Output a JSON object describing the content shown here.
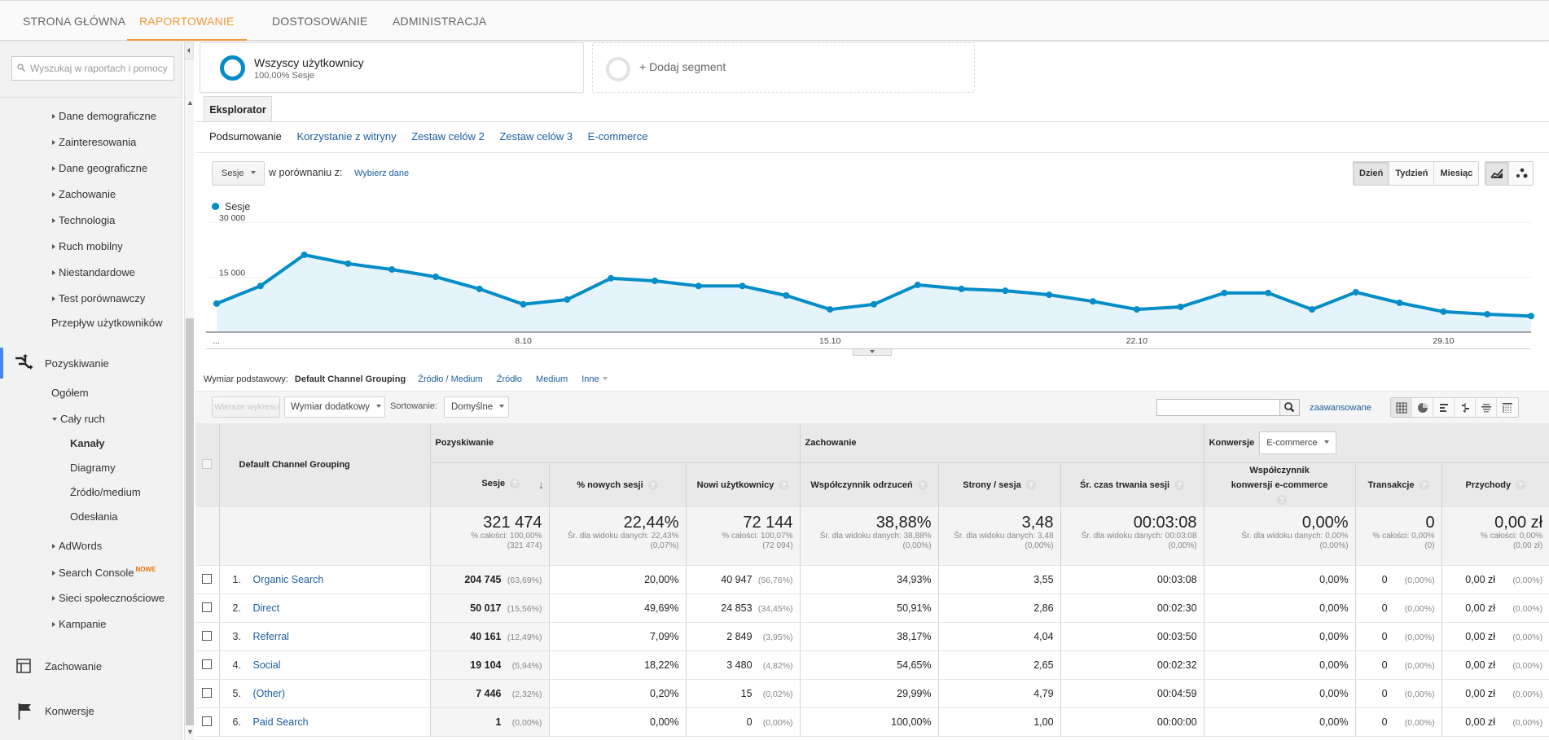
{
  "topnav": {
    "tabs": [
      {
        "label": "STRONA GŁÓWNA",
        "active": false
      },
      {
        "label": "RAPORTOWANIE",
        "active": true
      },
      {
        "label": "DOSTOSOWANIE",
        "active": false
      },
      {
        "label": "ADMINISTRACJA",
        "active": false
      }
    ],
    "accent_color": "#f09a38"
  },
  "sidebar": {
    "search_placeholder": "Wyszukaj w raportach i pomocy",
    "audience_items": [
      "Dane demograficzne",
      "Zainteresowania",
      "Dane geograficzne",
      "Zachowanie",
      "Technologia",
      "Ruch mobilny",
      "Niestandardowe",
      "Test porównawczy"
    ],
    "user_flow": "Przepływ użytkowników",
    "acquisition": {
      "label": "Pozyskiwanie",
      "overview": "Ogółem",
      "all_traffic": "Cały ruch",
      "all_traffic_items": [
        {
          "label": "Kanały",
          "active": true
        },
        {
          "label": "Diagramy",
          "active": false
        },
        {
          "label": "Źródło/medium",
          "active": false
        },
        {
          "label": "Odesłania",
          "active": false
        }
      ],
      "adwords": "AdWords",
      "search_console": "Search Console",
      "search_console_badge": "NOWE",
      "social": "Sieci społecznościowe",
      "campaigns": "Kampanie"
    },
    "behavior": "Zachowanie",
    "conversions": "Konwersje"
  },
  "segments": {
    "active": {
      "title": "Wszyscy użytkownicy",
      "subtitle": "100,00% Sesje"
    },
    "add": "+ Dodaj segment"
  },
  "explorer": {
    "tab": "Eksplorator",
    "subtabs": [
      {
        "label": "Podsumowanie",
        "active": true
      },
      {
        "label": "Korzystanie z witryny",
        "active": false
      },
      {
        "label": "Zestaw celów 2",
        "active": false
      },
      {
        "label": "Zestaw celów 3",
        "active": false
      },
      {
        "label": "E-commerce",
        "active": false
      }
    ],
    "metric_select": "Sesje",
    "compare_label": "w porównaniu z:",
    "compare_link": "Wybierz dane",
    "granularity": [
      {
        "label": "Dzień",
        "active": true
      },
      {
        "label": "Tydzień",
        "active": false
      },
      {
        "label": "Miesiąc",
        "active": false
      }
    ]
  },
  "chart_data": {
    "type": "area",
    "title": "",
    "legend": [
      "Sesje"
    ],
    "legend_position": "top-left",
    "series": [
      {
        "name": "Sesje",
        "color": "#058dc7",
        "values": [
          7800,
          12600,
          21100,
          18700,
          17100,
          15100,
          11800,
          7600,
          8900,
          14700,
          14000,
          12600,
          12600,
          10000,
          6200,
          7600,
          12900,
          11800,
          11300,
          10200,
          8400,
          6200,
          6900,
          10700,
          10700,
          6200,
          10900,
          8000,
          5600,
          4900,
          4400
        ]
      }
    ],
    "x_tick_labels": [
      {
        "index": 0,
        "label": "..."
      },
      {
        "index": 7,
        "label": "8.10"
      },
      {
        "index": 14,
        "label": "15.10"
      },
      {
        "index": 21,
        "label": "22.10"
      },
      {
        "index": 28,
        "label": "29.10"
      }
    ],
    "y_ticks": [
      {
        "value": 15000,
        "label": "15 000"
      },
      {
        "value": 30000,
        "label": "30 000"
      }
    ],
    "ylim": [
      0,
      30000
    ],
    "grid": true,
    "xlabel": "",
    "ylabel": ""
  },
  "dimension": {
    "label": "Wymiar podstawowy:",
    "active": "Default Channel Grouping",
    "links": [
      "Źródło / Medium",
      "Źródło",
      "Medium",
      "Inne"
    ]
  },
  "toolbar": {
    "plot_rows": "Wiersze wykresu",
    "secondary_dim": "Wymiar dodatkowy",
    "sort_label": "Sortowanie:",
    "sort_value": "Domyślne",
    "search_value": "",
    "advanced": "zaawansowane"
  },
  "table": {
    "dim_header": "Default Channel Grouping",
    "groups": {
      "acquisition": "Pozyskiwanie",
      "behavior": "Zachowanie",
      "conversions": "Konwersje",
      "conversions_select": "E-commerce"
    },
    "columns": [
      "Sesje",
      "% nowych sesji",
      "Nowi użytkownicy",
      "Współczynnik odrzuceń",
      "Strony / sesja",
      "Śr. czas trwania sesji",
      "Współczynnik konwersji e-commerce",
      "Transakcje",
      "Przychody"
    ],
    "totals": [
      {
        "value": "321 474",
        "line1": "% całości: 100,00%",
        "line2": "(321 474)"
      },
      {
        "value": "22,44%",
        "line1": "Śr. dla widoku danych: 22,43%",
        "line2": "(0,07%)"
      },
      {
        "value": "72 144",
        "line1": "% całości: 100,07%",
        "line2": "(72 094)"
      },
      {
        "value": "38,88%",
        "line1": "Śr. dla widoku danych: 38,88%",
        "line2": "(0,00%)"
      },
      {
        "value": "3,48",
        "line1": "Śr. dla widoku danych: 3,48",
        "line2": "(0,00%)"
      },
      {
        "value": "00:03:08",
        "line1": "Śr. dla widoku danych: 00:03:08",
        "line2": "(0,00%)"
      },
      {
        "value": "0,00%",
        "line1": "Śr. dla widoku danych: 0,00%",
        "line2": "(0,00%)"
      },
      {
        "value": "0",
        "line1": "% całości: 0,00%",
        "line2": "(0)"
      },
      {
        "value": "0,00 zł",
        "line1": "% całości: 0,00%",
        "line2": "(0,00 zł)"
      }
    ],
    "rows": [
      {
        "idx": "1.",
        "name": "Organic Search",
        "sessions": "204 745",
        "sessions_pct": "(63,69%)",
        "new_pct": "20,00%",
        "new_users": "40 947",
        "new_users_pct": "(56,76%)",
        "bounce": "34,93%",
        "pages": "3,55",
        "duration": "00:03:08",
        "conv": "0,00%",
        "trans": "0",
        "trans_pct": "(0,00%)",
        "rev": "0,00 zł",
        "rev_pct": "(0,00%)"
      },
      {
        "idx": "2.",
        "name": "Direct",
        "sessions": "50 017",
        "sessions_pct": "(15,56%)",
        "new_pct": "49,69%",
        "new_users": "24 853",
        "new_users_pct": "(34,45%)",
        "bounce": "50,91%",
        "pages": "2,86",
        "duration": "00:02:30",
        "conv": "0,00%",
        "trans": "0",
        "trans_pct": "(0,00%)",
        "rev": "0,00 zł",
        "rev_pct": "(0,00%)"
      },
      {
        "idx": "3.",
        "name": "Referral",
        "sessions": "40 161",
        "sessions_pct": "(12,49%)",
        "new_pct": "7,09%",
        "new_users": "2 849",
        "new_users_pct": "(3,95%)",
        "bounce": "38,17%",
        "pages": "4,04",
        "duration": "00:03:50",
        "conv": "0,00%",
        "trans": "0",
        "trans_pct": "(0,00%)",
        "rev": "0,00 zł",
        "rev_pct": "(0,00%)"
      },
      {
        "idx": "4.",
        "name": "Social",
        "sessions": "19 104",
        "sessions_pct": "(5,94%)",
        "new_pct": "18,22%",
        "new_users": "3 480",
        "new_users_pct": "(4,82%)",
        "bounce": "54,65%",
        "pages": "2,65",
        "duration": "00:02:32",
        "conv": "0,00%",
        "trans": "0",
        "trans_pct": "(0,00%)",
        "rev": "0,00 zł",
        "rev_pct": "(0,00%)"
      },
      {
        "idx": "5.",
        "name": "(Other)",
        "sessions": "7 446",
        "sessions_pct": "(2,32%)",
        "new_pct": "0,20%",
        "new_users": "15",
        "new_users_pct": "(0,02%)",
        "bounce": "29,99%",
        "pages": "4,79",
        "duration": "00:04:59",
        "conv": "0,00%",
        "trans": "0",
        "trans_pct": "(0,00%)",
        "rev": "0,00 zł",
        "rev_pct": "(0,00%)"
      },
      {
        "idx": "6.",
        "name": "Paid Search",
        "sessions": "1",
        "sessions_pct": "(0,00%)",
        "new_pct": "0,00%",
        "new_users": "0",
        "new_users_pct": "(0,00%)",
        "bounce": "100,00%",
        "pages": "1,00",
        "duration": "00:00:00",
        "conv": "0,00%",
        "trans": "0",
        "trans_pct": "(0,00%)",
        "rev": "0,00 zł",
        "rev_pct": "(0,00%)"
      }
    ]
  }
}
